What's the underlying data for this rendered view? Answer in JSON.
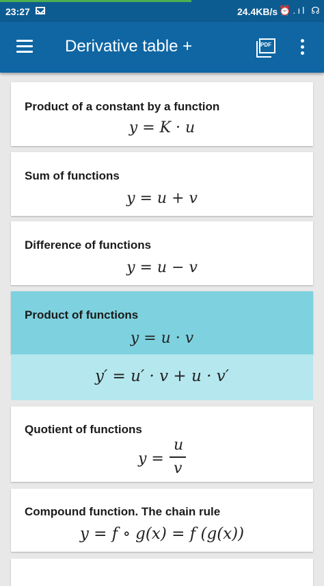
{
  "status": {
    "time": "23:27",
    "speed": "24.4KB/s",
    "icons": "⏰.ıl ☊"
  },
  "toolbar": {
    "title": "Derivative table +",
    "pdf_label": "PDF"
  },
  "items": [
    {
      "title": "Product of a constant by a function",
      "formula": "y = K · u"
    },
    {
      "title": "Sum of functions",
      "formula": "y = u + v"
    },
    {
      "title": "Difference of functions",
      "formula": "y = u − v"
    },
    {
      "title": "Product of functions",
      "formula": "y = u · v",
      "derivative": "y′ = u′ · v + u · v′"
    },
    {
      "title": "Quotient of functions",
      "formula_num": "u",
      "formula_den": "v",
      "formula_lhs": "y ="
    },
    {
      "title": "Compound function. The chain rule",
      "formula": "y = f ∘ g(x) = f (g(x))"
    }
  ],
  "colors": {
    "toolbar": "#0f66a3",
    "statusbar": "#0d5c91",
    "selected": "#7ed2df",
    "derivative": "#b5e7ee"
  }
}
